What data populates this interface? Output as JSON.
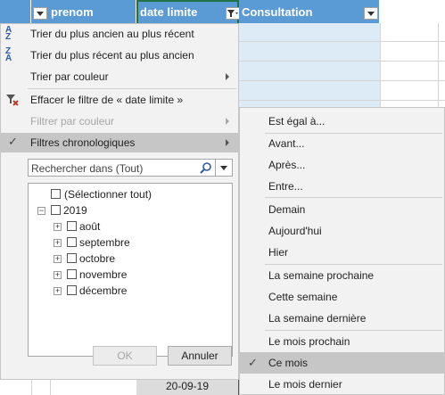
{
  "headers": {
    "prenom": "prenom",
    "date_limite": "date limite",
    "consultation": "Consultation"
  },
  "menu": {
    "sort_asc": "Trier du plus ancien au plus récent",
    "sort_desc": "Trier du plus récent au plus ancien",
    "sort_color": "Trier par couleur",
    "clear_filter": "Effacer le filtre de « date limite »",
    "filter_color": "Filtrer par couleur",
    "date_filters": "Filtres chronologiques",
    "search_placeholder": "Rechercher dans (Tout)",
    "ok": "OK",
    "cancel": "Annuler"
  },
  "tree": {
    "select_all": "(Sélectionner tout)",
    "year": "2019",
    "months": [
      "août",
      "septembre",
      "octobre",
      "novembre",
      "décembre"
    ]
  },
  "submenu": {
    "equals": "Est égal à...",
    "before": "Avant...",
    "after": "Après...",
    "between": "Entre...",
    "tomorrow": "Demain",
    "today": "Aujourd'hui",
    "yesterday": "Hier",
    "next_week": "La semaine prochaine",
    "this_week": "Cette semaine",
    "last_week": "La semaine dernière",
    "next_month": "Le mois prochain",
    "this_month": "Ce mois",
    "last_month": "Le mois dernier"
  },
  "cell_value": "20-09-19",
  "icons": {
    "sort_asc": "sort-az-icon",
    "sort_desc": "sort-za-icon",
    "clear_filter": "clear-filter-icon",
    "checked": "checkmark-icon",
    "search": "magnifier-icon",
    "filter": "filter-icon"
  },
  "colors": {
    "header": "#5b9bd5",
    "menu_bg": "#f2f2f2",
    "highlight": "#c6c6c6",
    "selected_column": "#217346"
  }
}
